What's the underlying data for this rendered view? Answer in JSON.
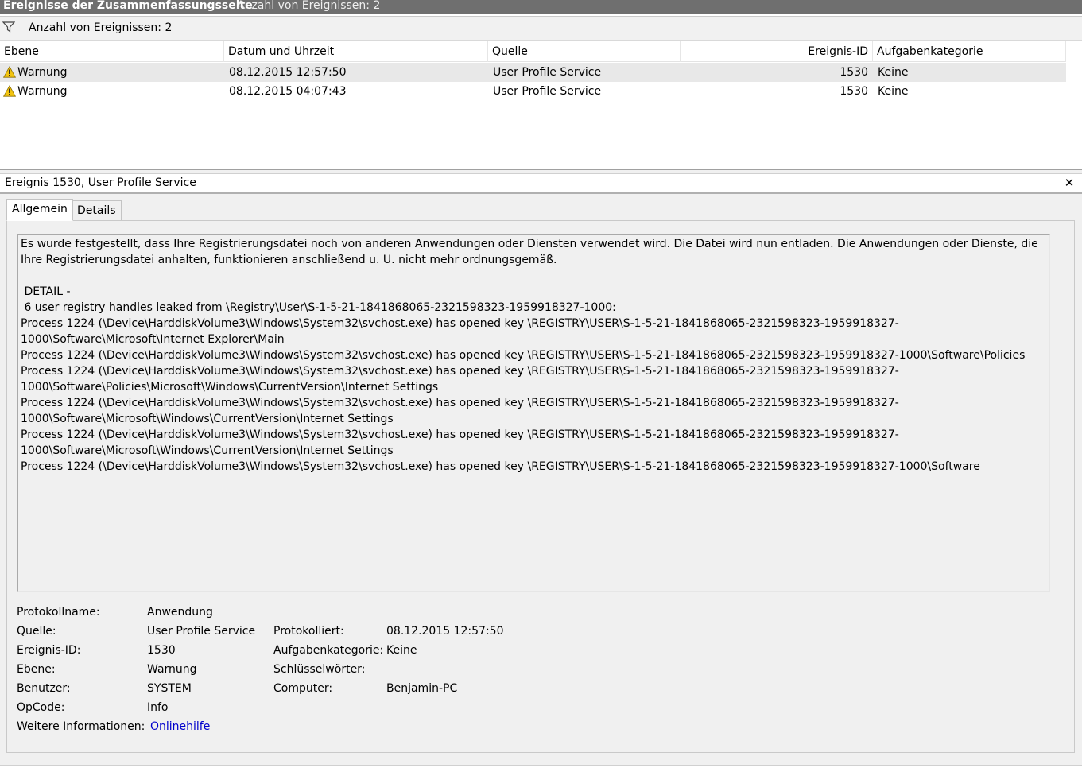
{
  "titlebar": {
    "title": "Ereignisse der Zusammenfassungsseite",
    "count_text": "Anzahl von Ereignissen: 2"
  },
  "filterbar": {
    "icon": "filter-icon",
    "text": "Anzahl von Ereignissen: 2"
  },
  "columns": {
    "level": "Ebene",
    "datetime": "Datum und Uhrzeit",
    "source": "Quelle",
    "event_id": "Ereignis-ID",
    "category": "Aufgabenkategorie"
  },
  "events": [
    {
      "level": "Warnung",
      "datetime": "08.12.2015 12:57:50",
      "source": "User Profile Service",
      "event_id": "1530",
      "category": "Keine",
      "selected": true
    },
    {
      "level": "Warnung",
      "datetime": "08.12.2015 04:07:43",
      "source": "User Profile Service",
      "event_id": "1530",
      "category": "Keine",
      "selected": false
    }
  ],
  "detail": {
    "header": "Ereignis 1530, User Profile Service",
    "close_icon": "close-icon",
    "tabs": {
      "general": "Allgemein",
      "details": "Details"
    },
    "description": "Es wurde festgestellt, dass Ihre Registrierungsdatei noch von anderen Anwendungen oder Diensten verwendet wird. Die Datei wird nun entladen. Die Anwendungen oder Dienste, die Ihre Registrierungsdatei anhalten, funktionieren anschließend u. U. nicht mehr ordnungsgemäß.\n\n DETAIL - \n 6 user registry handles leaked from \\Registry\\User\\S-1-5-21-1841868065-2321598323-1959918327-1000:\nProcess 1224 (\\Device\\HarddiskVolume3\\Windows\\System32\\svchost.exe) has opened key \\REGISTRY\\USER\\S-1-5-21-1841868065-2321598323-1959918327-1000\\Software\\Microsoft\\Internet Explorer\\Main\nProcess 1224 (\\Device\\HarddiskVolume3\\Windows\\System32\\svchost.exe) has opened key \\REGISTRY\\USER\\S-1-5-21-1841868065-2321598323-1959918327-1000\\Software\\Policies\nProcess 1224 (\\Device\\HarddiskVolume3\\Windows\\System32\\svchost.exe) has opened key \\REGISTRY\\USER\\S-1-5-21-1841868065-2321598323-1959918327-1000\\Software\\Policies\\Microsoft\\Windows\\CurrentVersion\\Internet Settings\nProcess 1224 (\\Device\\HarddiskVolume3\\Windows\\System32\\svchost.exe) has opened key \\REGISTRY\\USER\\S-1-5-21-1841868065-2321598323-1959918327-1000\\Software\\Microsoft\\Windows\\CurrentVersion\\Internet Settings\nProcess 1224 (\\Device\\HarddiskVolume3\\Windows\\System32\\svchost.exe) has opened key \\REGISTRY\\USER\\S-1-5-21-1841868065-2321598323-1959918327-1000\\Software\\Microsoft\\Windows\\CurrentVersion\\Internet Settings\nProcess 1224 (\\Device\\HarddiskVolume3\\Windows\\System32\\svchost.exe) has opened key \\REGISTRY\\USER\\S-1-5-21-1841868065-2321598323-1959918327-1000\\Software",
    "props": {
      "log_name_label": "Protokollname:",
      "log_name": "Anwendung",
      "source_label": "Quelle:",
      "source": "User Profile Service",
      "logged_label": "Protokolliert:",
      "logged": "08.12.2015 12:57:50",
      "event_id_label": "Ereignis-ID:",
      "event_id": "1530",
      "task_category_label": "Aufgabenkategorie:",
      "task_category": "Keine",
      "level_label": "Ebene:",
      "level": "Warnung",
      "keywords_label": "Schlüsselwörter:",
      "keywords": "",
      "user_label": "Benutzer:",
      "user": "SYSTEM",
      "computer_label": "Computer:",
      "computer": "Benjamin-PC",
      "opcode_label": "OpCode:",
      "opcode": "Info",
      "more_info_label": "Weitere Informationen:",
      "more_info_link": "Onlinehilfe"
    }
  }
}
